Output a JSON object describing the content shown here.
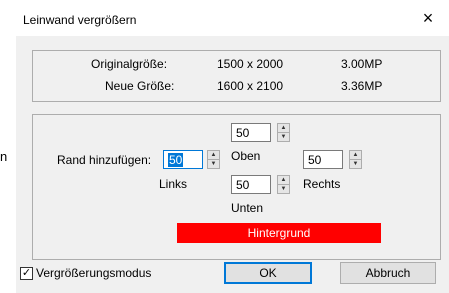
{
  "background_fragment": {
    "char": "n"
  },
  "window": {
    "title": "Leinwand vergrößern",
    "close_glyph": "×"
  },
  "info": {
    "original_label": "Originalgröße:",
    "original_size": "1500 x 2000",
    "original_mp": "3.00MP",
    "new_label": "Neue Größe:",
    "new_size": "1600 x 2100",
    "new_mp": "3.36MP"
  },
  "margins": {
    "add_label": "Rand hinzufügen:",
    "left_value": "50",
    "left_label": "Links",
    "top_value": "50",
    "top_label": "Oben",
    "bottom_value": "50",
    "bottom_label": "Unten",
    "right_value": "50",
    "right_label": "Rechts",
    "background_label": "Hintergrund",
    "background_color": "#ff0000"
  },
  "footer": {
    "enlarge_mode_label": "Vergrößerungsmodus",
    "enlarge_mode_checked": true,
    "check_glyph": "✓",
    "ok_label": "OK",
    "cancel_label": "Abbruch"
  },
  "icons": {
    "spin_up": "▲",
    "spin_down": "▼"
  }
}
